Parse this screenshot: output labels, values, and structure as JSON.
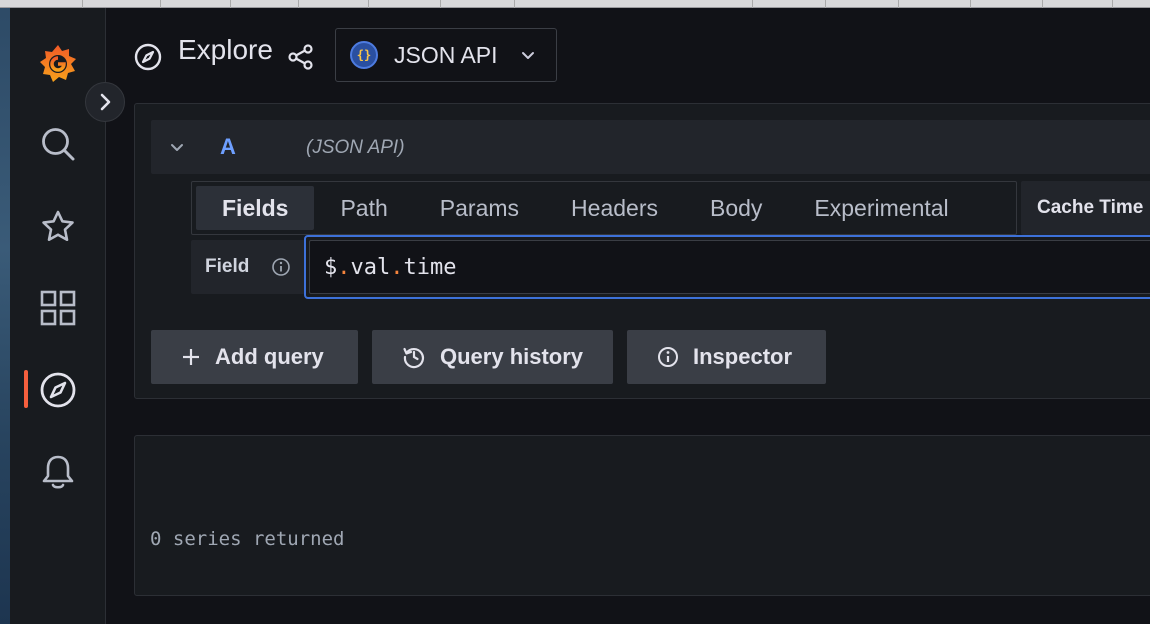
{
  "header": {
    "title": "Explore",
    "datasource_name": "JSON API",
    "datasource_logo_text": "{}"
  },
  "sidebar": {
    "items": [
      {
        "name": "grafana-home"
      },
      {
        "name": "search"
      },
      {
        "name": "starred"
      },
      {
        "name": "dashboards"
      },
      {
        "name": "explore",
        "active": true
      },
      {
        "name": "alerting"
      }
    ]
  },
  "query": {
    "ref_id": "A",
    "datasource_hint": "(JSON API)",
    "tabs": [
      "Fields",
      "Path",
      "Params",
      "Headers",
      "Body",
      "Experimental"
    ],
    "active_tab": "Fields",
    "cache_time_label": "Cache Time",
    "field_label": "Field",
    "field_value_parts": [
      "$",
      ".",
      "val",
      ".",
      "time"
    ]
  },
  "actions": {
    "add_query": "Add query",
    "query_history": "Query history",
    "inspector": "Inspector"
  },
  "results": {
    "status": "0 series returned"
  },
  "colors": {
    "accent_blue": "#3d71d9",
    "active_orange": "#f55f3e",
    "ref_id_blue": "#6e9fff"
  }
}
